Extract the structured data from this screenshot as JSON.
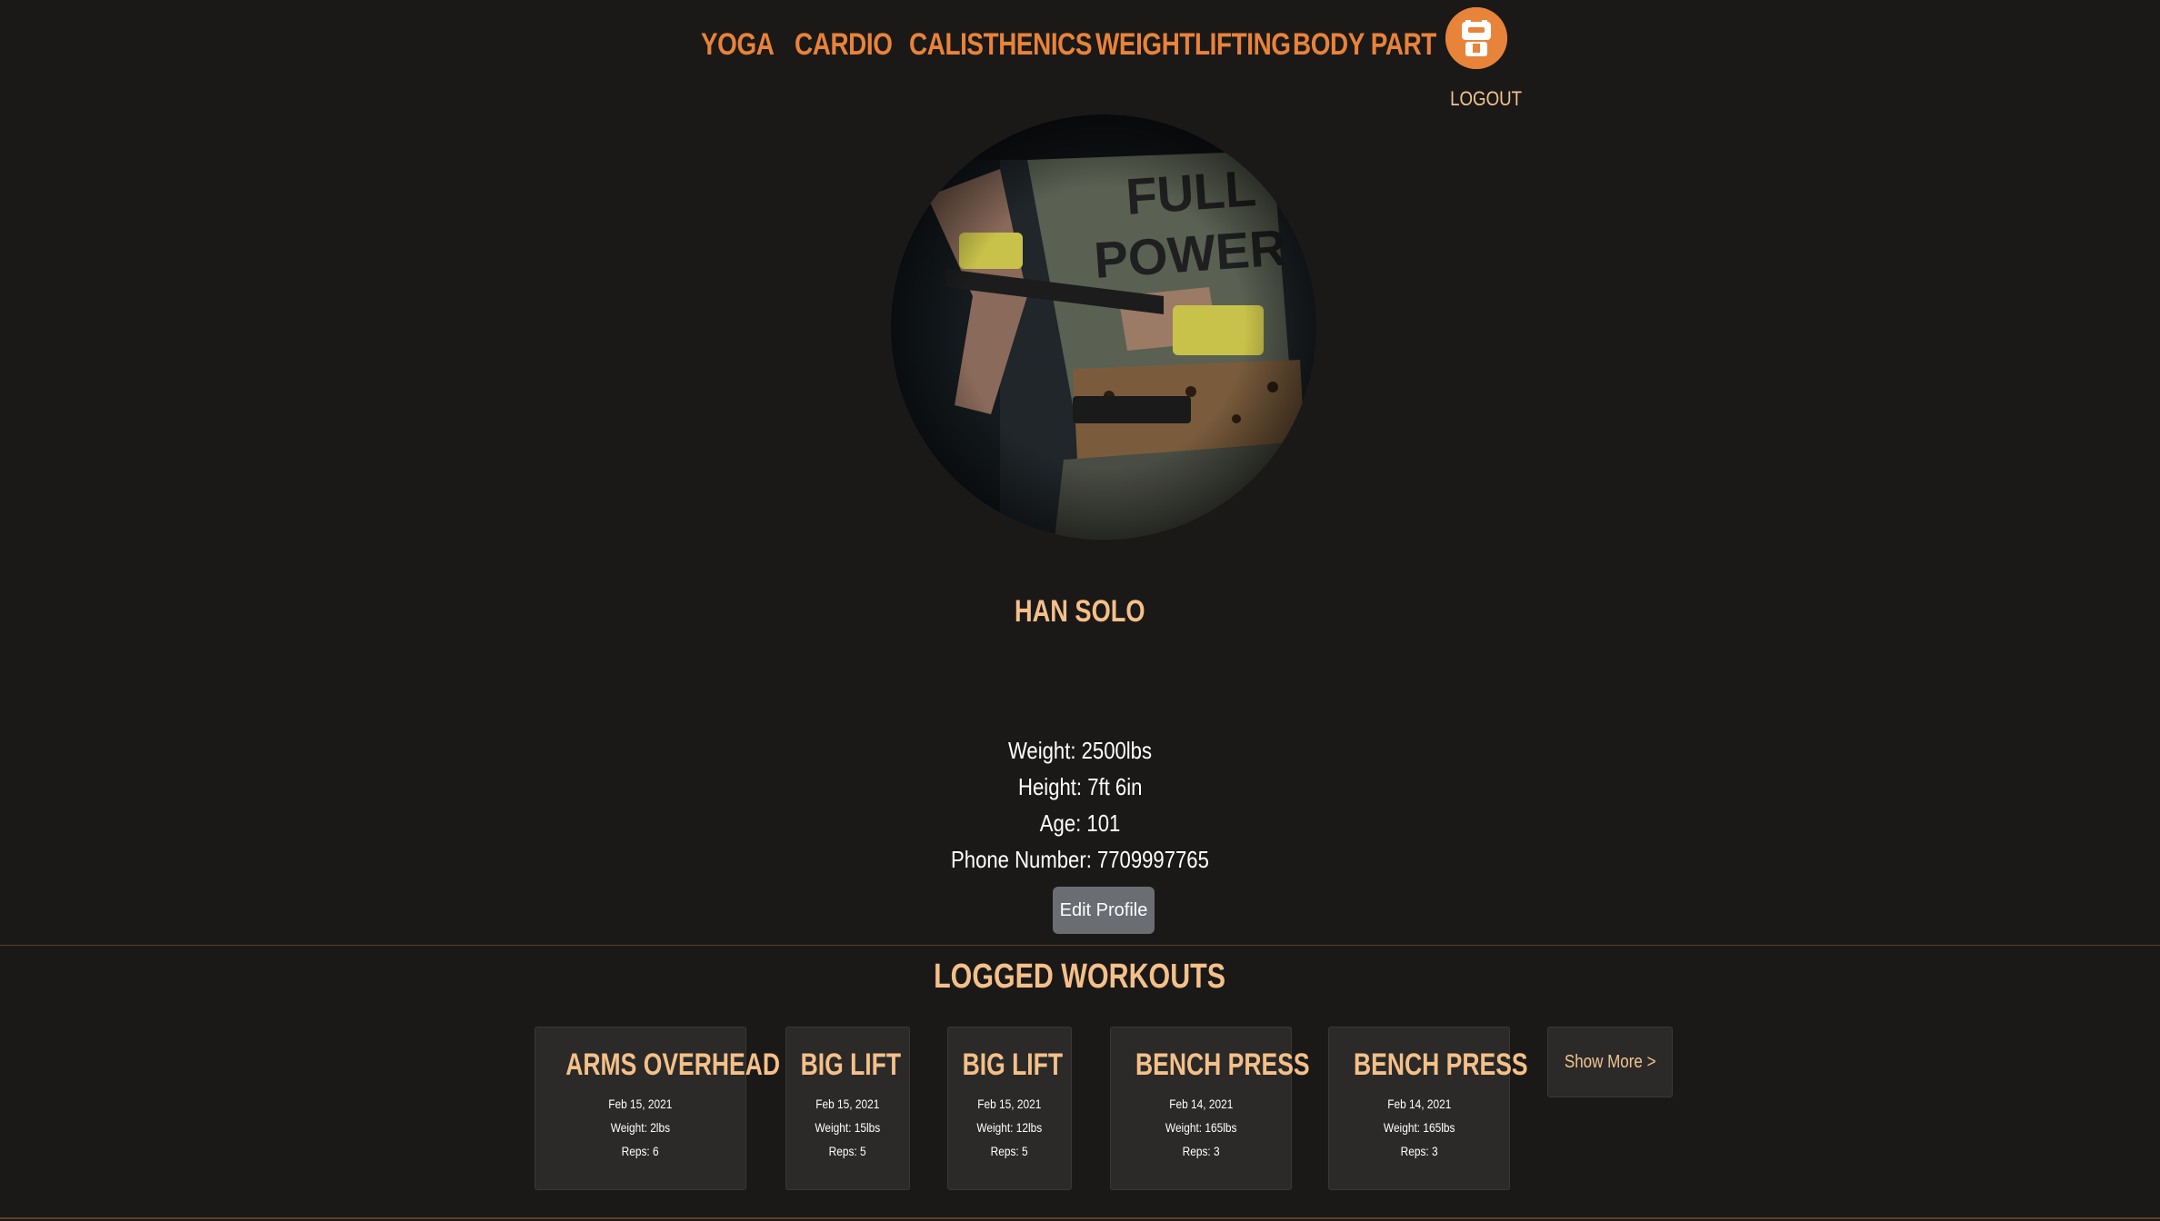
{
  "nav": {
    "links": [
      {
        "label": "YOGA"
      },
      {
        "label": "CARDIO"
      },
      {
        "label": "CALISTHENICS"
      },
      {
        "label": "WEIGHTLIFTING"
      },
      {
        "label": "BODY PART"
      }
    ],
    "logo_icon": "robot-logo-icon",
    "logout_label": "LOGOUT"
  },
  "profile": {
    "photo_text": "FULL POWER",
    "name": "HAN SOLO",
    "stats": [
      "Weight: 2500lbs",
      "Height: 7ft 6in",
      "Age: 101",
      "Phone Number: 7709997765"
    ],
    "edit_label": "Edit Profile"
  },
  "workouts": {
    "title": "LOGGED WORKOUTS",
    "cards": [
      {
        "title": "ARMS OVERHEAD",
        "date": "Feb 15, 2021",
        "weight": "Weight: 2lbs",
        "reps": "Reps: 6"
      },
      {
        "title": "BIG LIFT",
        "date": "Feb 15, 2021",
        "weight": "Weight: 15lbs",
        "reps": "Reps: 5"
      },
      {
        "title": "BIG LIFT",
        "date": "Feb 15, 2021",
        "weight": "Weight: 12lbs",
        "reps": "Reps: 5"
      },
      {
        "title": "BENCH PRESS",
        "date": "Feb 14, 2021",
        "weight": "Weight: 165lbs",
        "reps": "Reps: 3"
      },
      {
        "title": "BENCH PRESS",
        "date": "Feb 14, 2021",
        "weight": "Weight: 165lbs",
        "reps": "Reps: 3"
      }
    ],
    "show_more_label": "Show More >"
  },
  "colors": {
    "background": "#1b1918",
    "accent": "#e8833a",
    "heading": "#f4c089",
    "card": "#2b2a29",
    "button": "#6a6d72"
  }
}
